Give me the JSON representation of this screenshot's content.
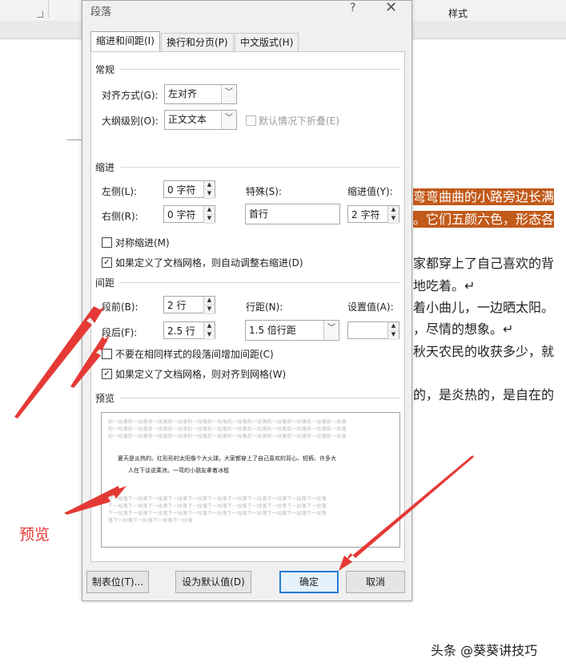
{
  "ribbon": {
    "styles_label": "样式"
  },
  "document": {
    "lines": [
      {
        "text": "弯弯曲曲的小路旁边长满",
        "highlight": true
      },
      {
        "text": "。它们五颜六色，形态各",
        "highlight": true
      },
      {
        "text": "家都穿上了自己喜欢的背",
        "highlight": false
      },
      {
        "text": "地吃着。↵",
        "highlight": false
      },
      {
        "text": "着小曲儿，一边晒太阳。",
        "highlight": false
      },
      {
        "text": "，尽情的想象。↵",
        "highlight": false
      },
      {
        "text": "秋天农民的收获多少，就",
        "highlight": false
      },
      {
        "text": "的，是炎热的，是自在的",
        "highlight": false
      }
    ]
  },
  "dialog": {
    "title": "段落",
    "help": "?",
    "close": "✕",
    "tabs": [
      "缩进和间距(I)",
      "换行和分页(P)",
      "中文版式(H)"
    ],
    "general": {
      "section": "常规",
      "alignment_label": "对齐方式(G):",
      "alignment_value": "左对齐",
      "outline_label": "大纲级别(O):",
      "outline_value": "正文文本",
      "collapse_label": "默认情况下折叠(E)"
    },
    "indent": {
      "section": "缩进",
      "left_label": "左侧(L):",
      "left_value": "0 字符",
      "right_label": "右侧(R):",
      "right_value": "0 字符",
      "special_label": "特殊(S):",
      "special_value": "首行",
      "by_label": "缩进值(Y):",
      "by_value": "2 字符",
      "mirror_label": "对称缩进(M)",
      "auto_right_label": "如果定义了文档网格，则自动调整右缩进(D)"
    },
    "spacing": {
      "section": "间距",
      "before_label": "段前(B):",
      "before_value": "2 行",
      "after_label": "段后(F):",
      "after_value": "2.5 行",
      "line_label": "行距(N):",
      "line_value": "1.5 倍行距",
      "at_label": "设置值(A):",
      "at_value": "",
      "dont_add_label": "不要在相同样式的段落间增加间距(C)",
      "snap_grid_label": "如果定义了文档网格，则对齐到网格(W)"
    },
    "preview": {
      "section": "预览",
      "prev_text": "前一段落前一段落前一段落前一段落前一段落前一段落前一段落前一段落前一段落前一段落前一段落前一段落",
      "main_line1": "夏天是炎热的。红形形的太阳像个大火球。大家都穿上了自己喜欢的背心、短裤。许多大",
      "main_line2": "人在下谈说乘凉。一弯的小朋友拿着冰棍",
      "next_text": "下一段落下一段落下一段落下一段落下一段落下一段落下一段落下一段落下一段落下一段落下一段落",
      "next_last": "落下一段落下一段落下一段落下一段落"
    },
    "buttons": {
      "tabs": "制表位(T)...",
      "set_default": "设为默认值(D)",
      "ok": "确定",
      "cancel": "取消"
    }
  },
  "annotation": {
    "label": "预览",
    "color": "#e53935"
  },
  "watermark": "头条 @葵葵讲技巧"
}
